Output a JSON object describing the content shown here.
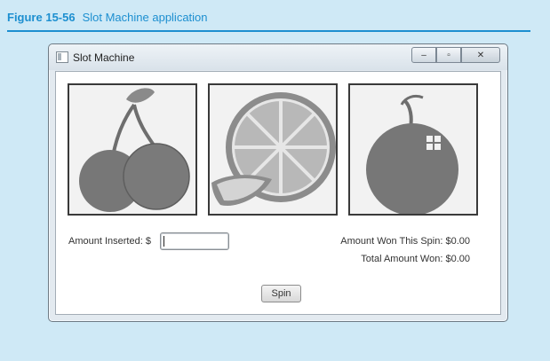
{
  "figure": {
    "number": "Figure 15-56",
    "caption": "Slot Machine application"
  },
  "window": {
    "title": "Slot Machine",
    "minimize": "–",
    "maximize": "▫",
    "close": "✕"
  },
  "slots": [
    {
      "icon": "cherries-icon"
    },
    {
      "icon": "orange-icon"
    },
    {
      "icon": "apple-icon"
    }
  ],
  "amount": {
    "label": "Amount Inserted: $",
    "value": ""
  },
  "results": {
    "spin_label": "Amount Won This Spin: $0.00",
    "total_label": "Total Amount Won: $0.00"
  },
  "spin_button": "Spin",
  "colors": {
    "accent": "#1d8fd0",
    "fruit": "#777777",
    "frame": "#3a3a3a"
  }
}
